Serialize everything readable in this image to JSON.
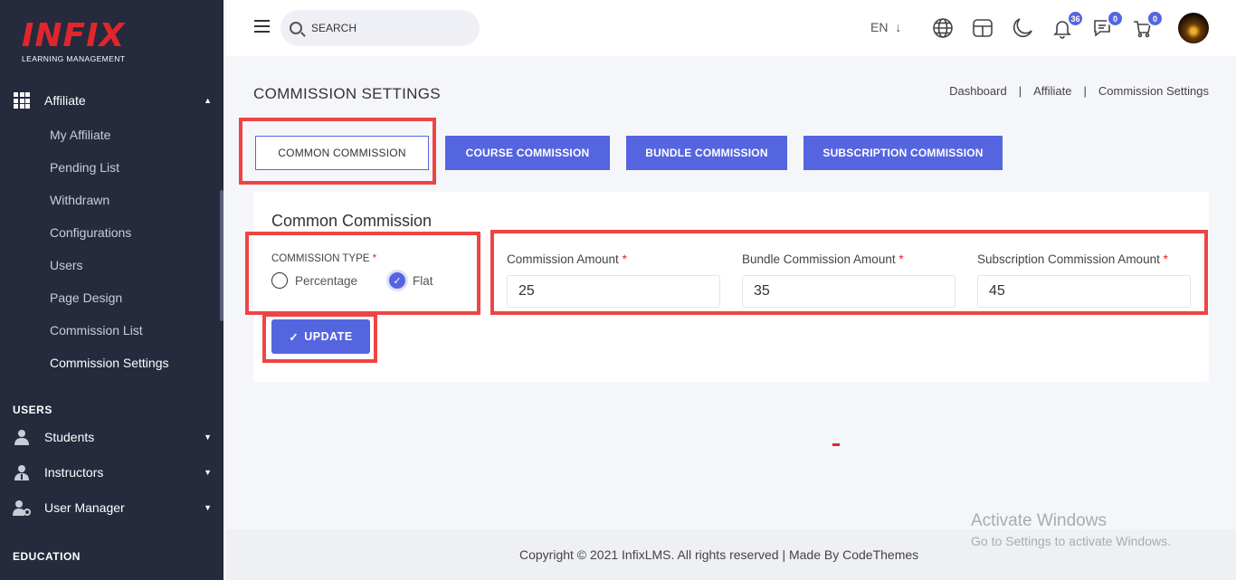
{
  "brand": {
    "name": "INFIX",
    "tagline": "LEARNING MANAGEMENT",
    "color": "#e0262b"
  },
  "sidebar": {
    "affiliate": {
      "label": "Affiliate",
      "icon": "grid-icon",
      "children": [
        "My Affiliate",
        "Pending List",
        "Withdrawn",
        "Configurations",
        "Users",
        "Page Design",
        "Commission List",
        "Commission Settings"
      ],
      "active": "Commission Settings"
    },
    "users_section": "USERS",
    "users_items": [
      {
        "label": "Students",
        "icon": "user-icon"
      },
      {
        "label": "Instructors",
        "icon": "instructor-icon"
      },
      {
        "label": "User Manager",
        "icon": "user-gear-icon"
      }
    ],
    "education_section": "EDUCATION"
  },
  "header": {
    "search_placeholder": "SEARCH",
    "language": "EN",
    "notifications_count": "36",
    "messages_count": "0",
    "cart_count": "0"
  },
  "page": {
    "title": "COMMISSION SETTINGS",
    "breadcrumb": [
      "Dashboard",
      "Affiliate",
      "Commission Settings"
    ]
  },
  "tabs": [
    "COMMON COMMISSION",
    "COURSE COMMISSION",
    "BUNDLE COMMISSION",
    "SUBSCRIPTION COMMISSION"
  ],
  "form": {
    "title": "Common Commission",
    "commission_type_label": "COMMISSION TYPE",
    "options": [
      "Percentage",
      "Flat"
    ],
    "selected": "Flat",
    "commission_amount_label": "Commission Amount",
    "commission_amount": "25",
    "bundle_amount_label": "Bundle Commission Amount",
    "bundle_amount": "35",
    "subscription_amount_label": "Subscription Commission Amount",
    "subscription_amount": "45",
    "required_mark": "*",
    "update_label": "UPDATE"
  },
  "footer": {
    "text": "Copyright © 2021 InfixLMS. All rights reserved | Made By CodeThemes"
  },
  "watermark": {
    "line1": "Activate Windows",
    "line2": "Go to Settings to activate Windows."
  },
  "colors": {
    "sidebar": "#252a3d",
    "accent": "#5565e0",
    "highlight": "#ef4444"
  }
}
